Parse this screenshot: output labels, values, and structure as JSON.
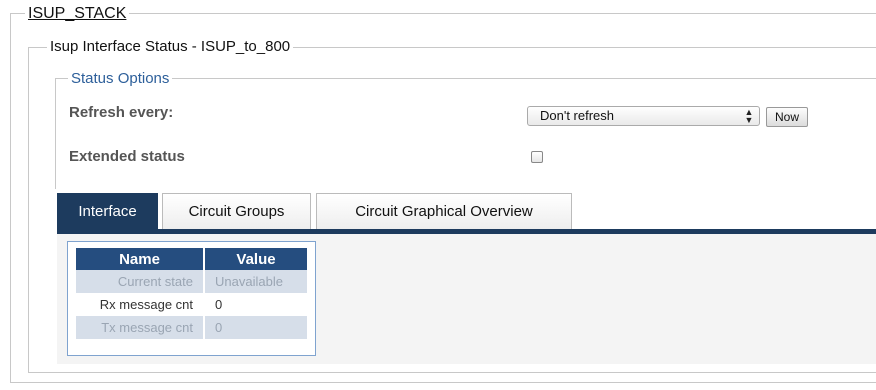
{
  "stack_legend": "ISUP_STACK",
  "interface_legend": "Isup Interface Status - ISUP_to_800",
  "status_options": {
    "legend": "Status Options",
    "refresh_label": "Refresh every:",
    "refresh_value": "Don't refresh",
    "now_button": "Now",
    "extended_label": "Extended status",
    "extended_checked": false
  },
  "tabs": [
    {
      "label": "Interface",
      "active": true
    },
    {
      "label": "Circuit Groups",
      "active": false
    },
    {
      "label": "Circuit Graphical Overview",
      "active": false
    }
  ],
  "table": {
    "headers": [
      "Name",
      "Value"
    ],
    "rows": [
      {
        "name": "Current state",
        "value": "Unavailable"
      },
      {
        "name": "Rx message cnt",
        "value": "0"
      },
      {
        "name": "Tx message cnt",
        "value": "0"
      }
    ]
  },
  "colors": {
    "tab_active": "#1d3b5e",
    "table_header": "#254d7f",
    "legend_blue": "#2d5f9a"
  }
}
